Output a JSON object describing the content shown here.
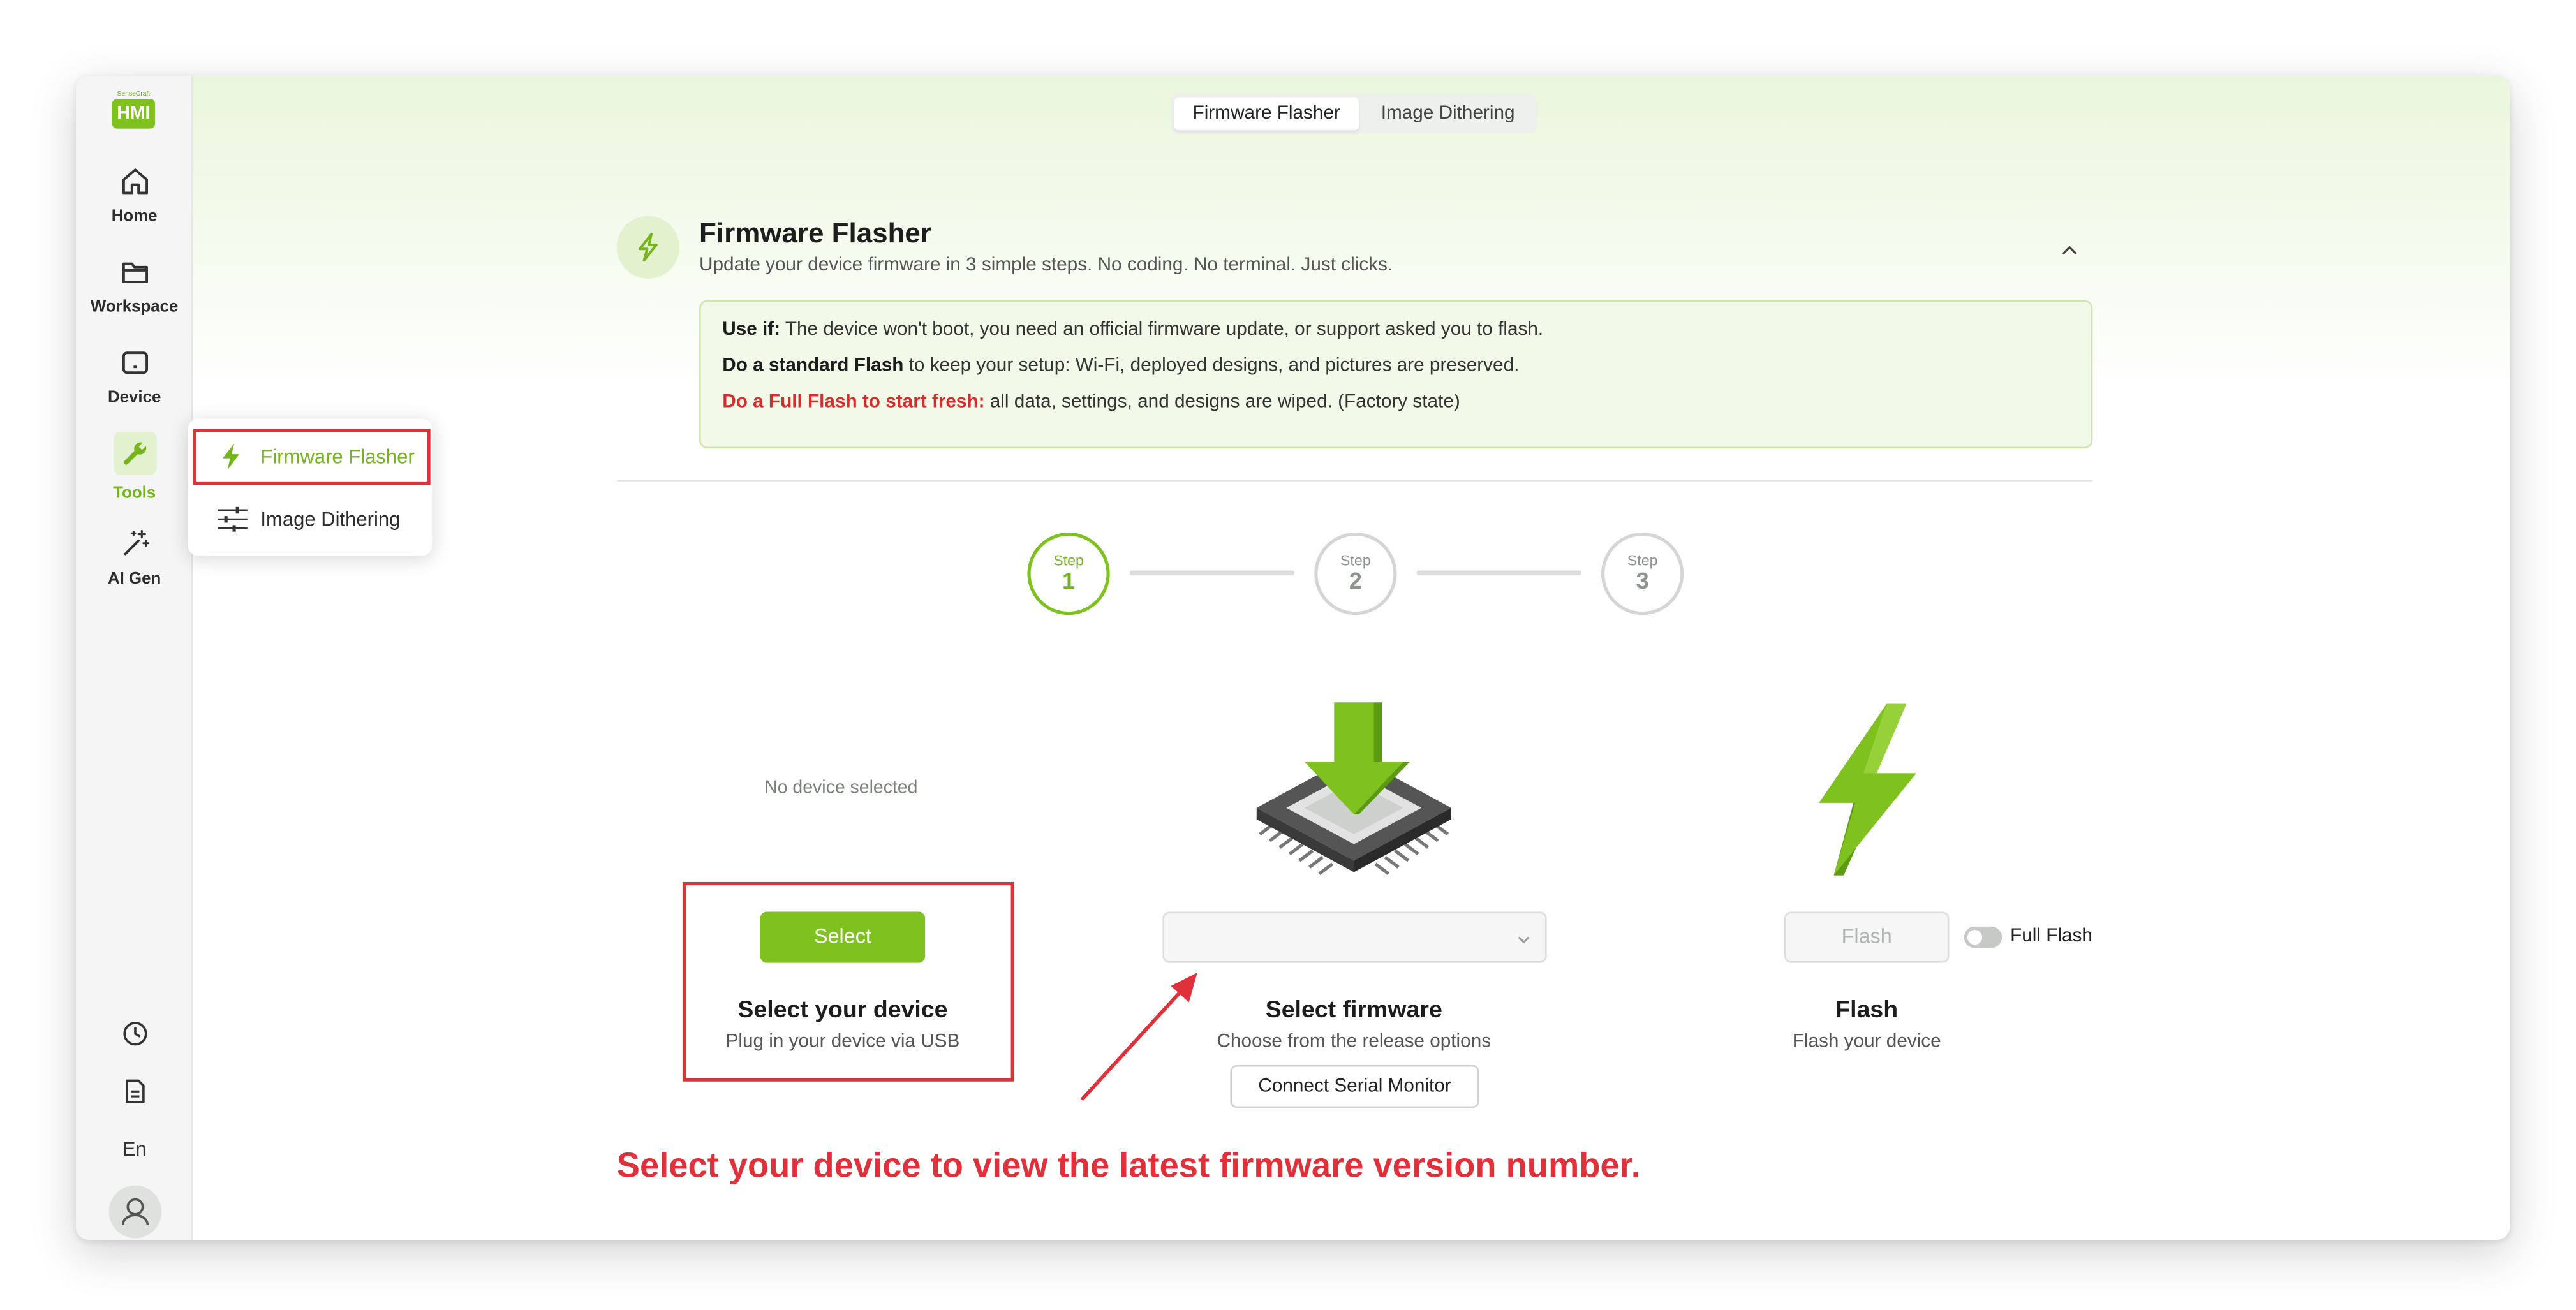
{
  "app": {
    "logo_small": "SenseCraft",
    "logo_text": "HMI"
  },
  "sidebar": {
    "items": [
      {
        "label": "Home",
        "icon": "home-icon"
      },
      {
        "label": "Workspace",
        "icon": "folder-icon"
      },
      {
        "label": "Device",
        "icon": "device-icon"
      },
      {
        "label": "Tools",
        "icon": "wrench-icon",
        "active": true
      },
      {
        "label": "AI Gen",
        "icon": "magic-wand-icon"
      }
    ],
    "bottom": {
      "history_icon": "clock-icon",
      "docs_icon": "document-icon",
      "language": "En",
      "user_icon": "user-icon"
    }
  },
  "tools_menu": {
    "items": [
      {
        "label": "Firmware Flasher",
        "icon": "lightning-icon",
        "active": true
      },
      {
        "label": "Image Dithering",
        "icon": "sliders-icon"
      }
    ]
  },
  "tabs": [
    {
      "label": "Firmware Flasher",
      "active": true
    },
    {
      "label": "Image Dithering",
      "active": false
    }
  ],
  "header": {
    "title": "Firmware Flasher",
    "subtitle": "Update your device firmware in 3 simple steps. No coding. No terminal. Just clicks."
  },
  "info": {
    "line1_bold": "Use if:",
    "line1_text": " The device won't boot, you need an official firmware update, or support asked you to flash.",
    "line2_bold": "Do a standard Flash",
    "line2_text": " to keep your setup: Wi-Fi, deployed designs, and pictures are preserved.",
    "line3_bold": "Do a Full Flash to start fresh:",
    "line3_text": " all data, settings, and designs are wiped. (Factory state)"
  },
  "steps": [
    {
      "label": "Step",
      "number": "1",
      "active": true
    },
    {
      "label": "Step",
      "number": "2",
      "active": false
    },
    {
      "label": "Step",
      "number": "3",
      "active": false
    }
  ],
  "device": {
    "status": "No device selected",
    "button": "Select",
    "title": "Select your device",
    "subtitle": "Plug in your device via USB"
  },
  "firmware": {
    "dropdown_value": "",
    "title": "Select firmware",
    "subtitle": "Choose from the release options",
    "serial_button": "Connect Serial Monitor"
  },
  "flash": {
    "button": "Flash",
    "toggle_label": "Full Flash",
    "toggle_on": false,
    "title": "Flash",
    "subtitle": "Flash your device"
  },
  "annotation": {
    "text": "Select your device to view the latest firmware version number.",
    "color": "#e0303a"
  },
  "colors": {
    "accent": "#7fc21f",
    "highlight": "#e0303a"
  }
}
